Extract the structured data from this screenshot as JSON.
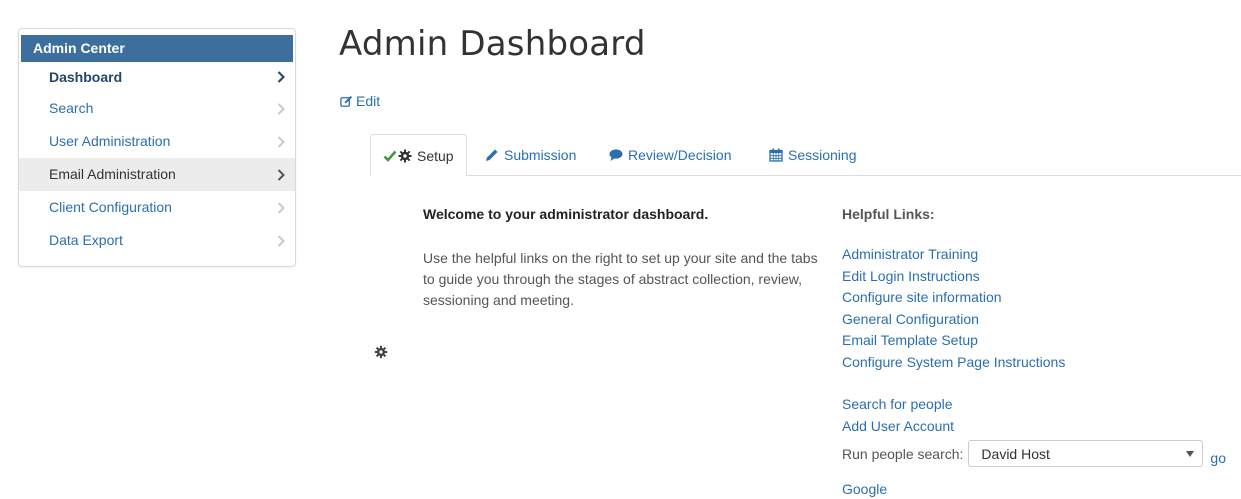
{
  "sidebar": {
    "header": "Admin Center",
    "items": [
      {
        "label": "Dashboard"
      },
      {
        "label": "Search"
      },
      {
        "label": "User Administration"
      },
      {
        "label": "Email Administration"
      },
      {
        "label": "Client Configuration"
      },
      {
        "label": "Data Export"
      }
    ]
  },
  "main": {
    "title": "Admin Dashboard",
    "edit_label": "Edit",
    "tabs": [
      {
        "label": "Setup",
        "icon": "check-gear-icon"
      },
      {
        "label": "Submission",
        "icon": "pencil-icon"
      },
      {
        "label": "Review/Decision",
        "icon": "comment-icon"
      },
      {
        "label": "Sessioning",
        "icon": "calendar-icon"
      }
    ],
    "welcome_title": "Welcome to your administrator dashboard.",
    "welcome_body": "Use the helpful links on the right to set up your site and the tabs to guide you through the stages of abstract collection, review, sessioning and meeting.",
    "helpful_links_title": "Helpful Links:",
    "links_group1": [
      "Administrator Training",
      "Edit Login Instructions",
      "Configure site information",
      "General Configuration",
      "Email Template Setup",
      "Configure System Page Instructions"
    ],
    "links_group2": [
      "Search for people",
      "Add User Account"
    ],
    "people_search": {
      "label": "Run people search:",
      "selected": "David Host",
      "go_label": "go"
    },
    "google_label": "Google"
  },
  "colors": {
    "accent": "#3d6f9e",
    "link": "#2a6fb0",
    "check": "#3c9a3c"
  }
}
